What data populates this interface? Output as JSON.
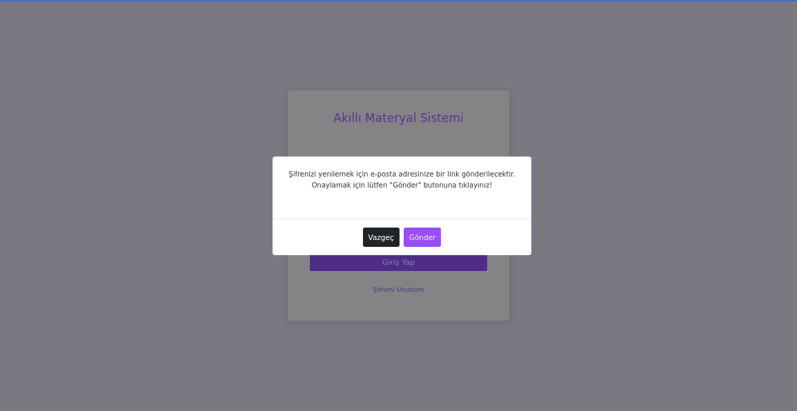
{
  "login_card": {
    "title": "Akıllı Materyal Sistemi",
    "login_button": "Giriş Yap",
    "forgot_link": "Şifremi Unuttum"
  },
  "dialog": {
    "message": "Şifrenizi yenilemek için e-posta adresinize bir link gönderilecektir. Onaylamak için lütfen \"Gönder\" butonuna tıklayınız!",
    "buttons": [
      {
        "label": "Vazgeç",
        "kind": "secondary"
      },
      {
        "label": "Gönder",
        "kind": "primary"
      }
    ]
  }
}
